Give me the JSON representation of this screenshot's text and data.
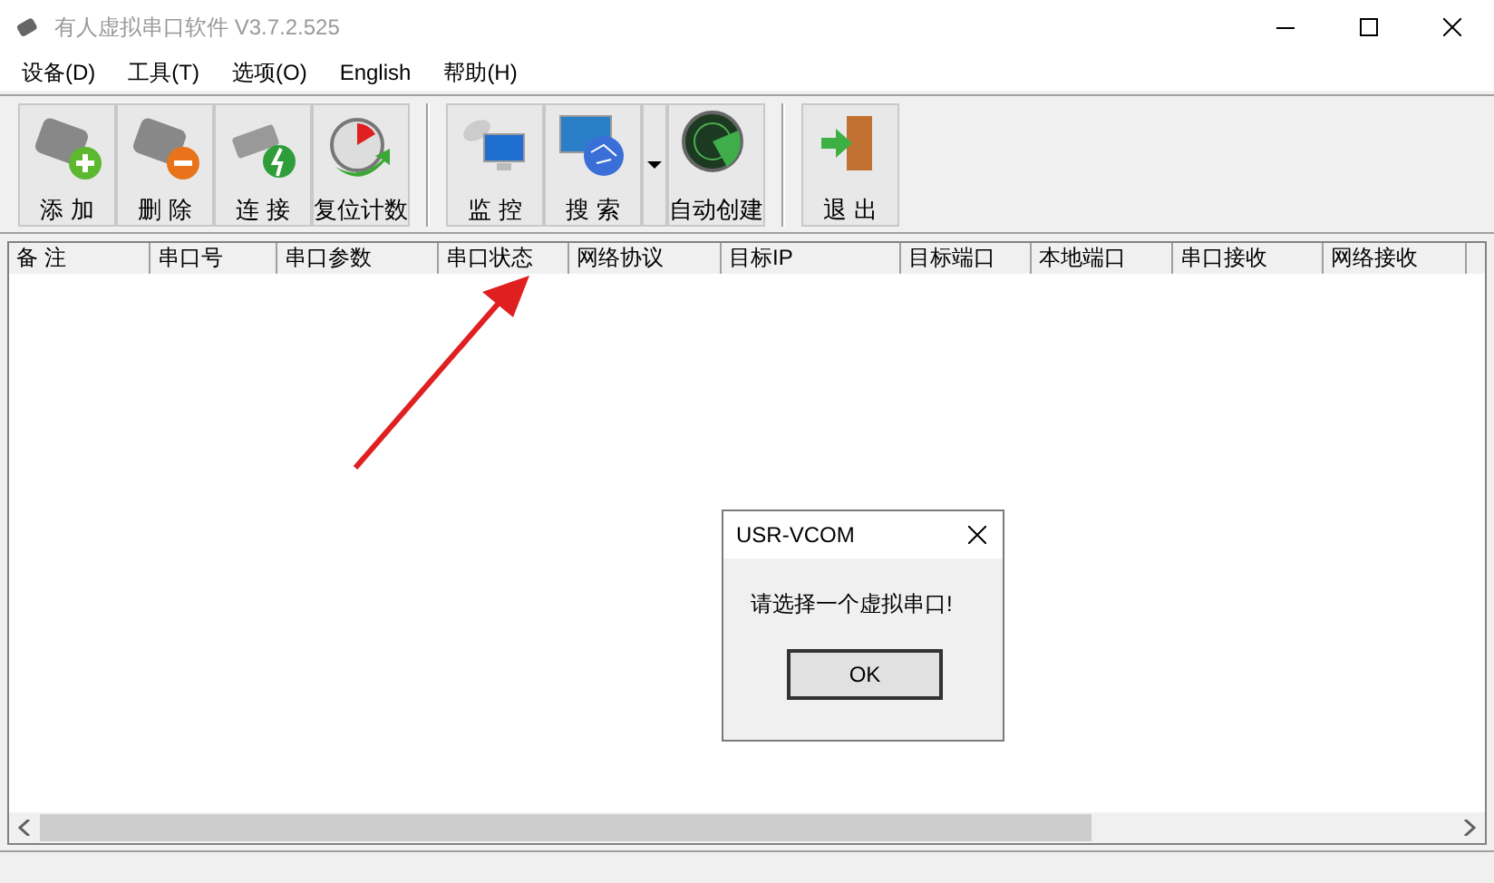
{
  "window": {
    "title": "有人虚拟串口软件 V3.7.2.525"
  },
  "menu": [
    "设备(D)",
    "工具(T)",
    "选项(O)",
    "English",
    "帮助(H)"
  ],
  "toolbar": [
    {
      "kind": "add",
      "label": "添 加"
    },
    {
      "kind": "delete",
      "label": "删 除"
    },
    {
      "kind": "connect",
      "label": "连 接"
    },
    {
      "kind": "reset",
      "label": "复位计数"
    },
    {
      "kind": "separator"
    },
    {
      "kind": "monitor",
      "label": "监 控"
    },
    {
      "kind": "search",
      "label": "搜 索",
      "dropdown": true
    },
    {
      "kind": "radar",
      "label": "自动创建"
    },
    {
      "kind": "separator"
    },
    {
      "kind": "exit",
      "label": "退 出"
    }
  ],
  "table": {
    "columns": [
      "备 注",
      "串口号",
      "串口参数",
      "串口状态",
      "网络协议",
      "目标IP",
      "目标端口",
      "本地端口",
      "串口接收",
      "网络接收"
    ]
  },
  "dialog": {
    "title": "USR-VCOM",
    "message": "请选择一个虚拟串口!",
    "buttons": [
      "OK"
    ]
  }
}
